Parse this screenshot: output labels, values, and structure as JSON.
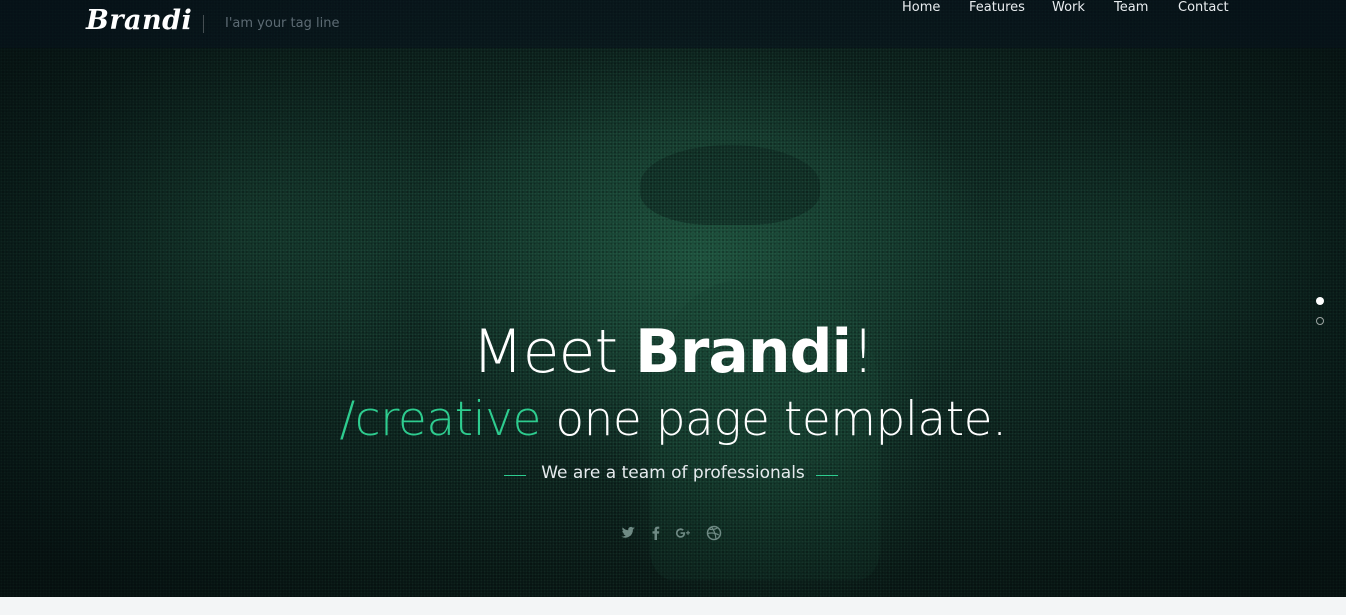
{
  "header": {
    "logo": "Brandi",
    "tagline": "I'am your tag line",
    "nav": [
      {
        "label": "Home"
      },
      {
        "label": "Features"
      },
      {
        "label": "Work"
      },
      {
        "label": "Team"
      },
      {
        "label": "Contact"
      }
    ]
  },
  "hero": {
    "headline_prefix": "Meet ",
    "headline_brand": "Brandi",
    "headline_suffix": "!",
    "subhead_accent": "/creative",
    "subhead_rest": " one page template.",
    "team_line": "We are a team of professionals",
    "socials": [
      "twitter-icon",
      "facebook-icon",
      "google-plus-icon",
      "dribbble-icon"
    ]
  },
  "slider": {
    "active_index": 0,
    "count": 2
  },
  "colors": {
    "accent": "#2ecc8f",
    "text": "#ffffff",
    "tagline": "#5d6b74"
  }
}
